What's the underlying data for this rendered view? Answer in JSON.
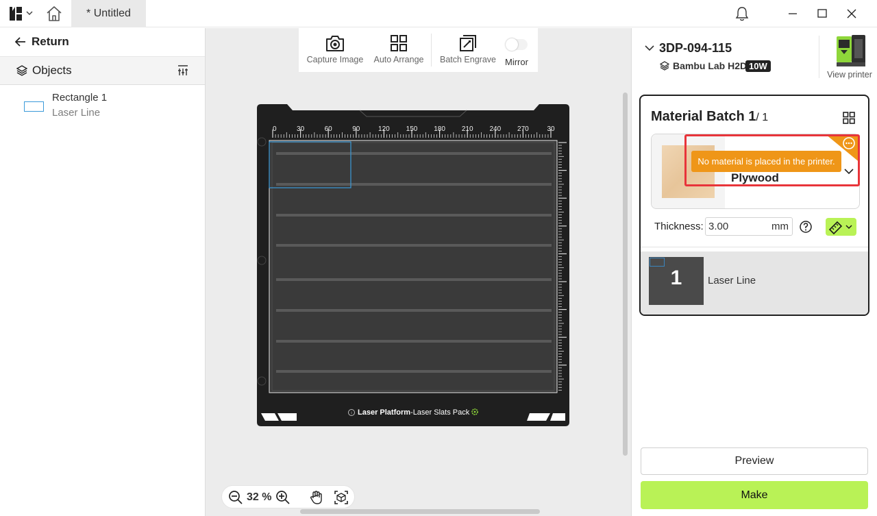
{
  "titlebar": {
    "doc_title": "* Untitled"
  },
  "left_panel": {
    "return_label": "Return",
    "objects_label": "Objects",
    "objects": [
      {
        "name": "Rectangle 1",
        "type": "Laser Line"
      }
    ]
  },
  "toolbar": {
    "capture_label": "Capture Image",
    "arrange_label": "Auto Arrange",
    "batch_label": "Batch Engrave",
    "mirror_label": "Mirror",
    "mirror_on": false
  },
  "plate": {
    "ruler_x": [
      "0",
      "30",
      "60",
      "90",
      "120",
      "150",
      "180",
      "210",
      "240",
      "270",
      "30"
    ],
    "platform_bold": "Laser Platform",
    "platform_rest": "-Laser Slats Pack"
  },
  "zoom": {
    "value": "32 %"
  },
  "printer": {
    "name": "3DP-094-115",
    "model": "Bambu Lab H2D",
    "power": "10W",
    "view_label": "View printer"
  },
  "batch": {
    "title": "Material Batch 1",
    "count": "/ 1",
    "material_name": "Plywood",
    "warning": "No material is placed in the printer.",
    "thickness_label": "Thickness:",
    "thickness_value": "3.00",
    "thickness_unit": "mm",
    "layer_number": "1",
    "layer_label": "Laser Line"
  },
  "actions": {
    "preview_label": "Preview",
    "make_label": "Make"
  },
  "colors": {
    "accent": "#b9f256",
    "warning": "#ef9618",
    "alert_border": "#e8343a",
    "object_outline": "#3a9ad9"
  }
}
